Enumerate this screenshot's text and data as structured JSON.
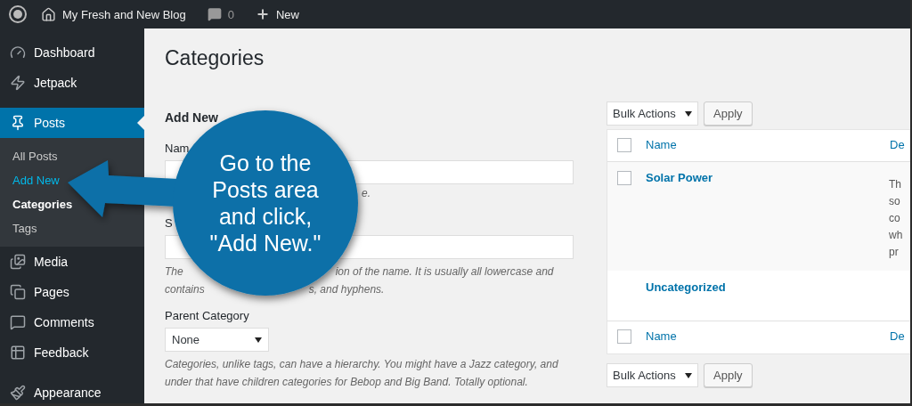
{
  "admin_bar": {
    "site_name": "My Fresh and New Blog",
    "comments_count": "0",
    "new_label": "New"
  },
  "sidebar": {
    "items": [
      {
        "label": "Dashboard",
        "selected": false
      },
      {
        "label": "Jetpack",
        "selected": false
      },
      {
        "label": "Posts",
        "selected": true,
        "children": [
          {
            "label": "All Posts",
            "selected": false,
            "hovered": false
          },
          {
            "label": "Add New",
            "selected": false,
            "hovered": true
          },
          {
            "label": "Categories",
            "selected": true,
            "hovered": false
          },
          {
            "label": "Tags",
            "selected": false,
            "hovered": false
          }
        ]
      },
      {
        "label": "Media",
        "selected": false
      },
      {
        "label": "Pages",
        "selected": false
      },
      {
        "label": "Comments",
        "selected": false
      },
      {
        "label": "Feedback",
        "selected": false
      },
      {
        "label": "Appearance",
        "selected": false
      }
    ]
  },
  "page_title": "Categories",
  "form": {
    "heading": "Add New",
    "name_label": "Nam",
    "name_hint": "e.",
    "slug_label": "S",
    "slug_hint_lines": [
      [
        "The",
        "ion of the name. It is usually all lowercase and"
      ],
      [
        "contains",
        "s, and hyphens."
      ]
    ],
    "parent_label": "Parent Category",
    "parent_value": "None",
    "parent_hint": "Categories, unlike tags, can have a hierarchy. You might have a Jazz category, and under that have children categories for Bebop and Big Band. Totally optional."
  },
  "table": {
    "top_tools": {
      "bulk_actions": "Bulk Actions",
      "apply": "Apply"
    },
    "header": {
      "columns": [
        "Name",
        "De"
      ],
      "checked": false
    },
    "rows": [
      {
        "name": "Solar Power",
        "kind": "checkable",
        "checked": false,
        "description_lines": [
          "Th",
          "so",
          "co",
          "wh",
          "pr"
        ]
      },
      {
        "name": "Uncategorized",
        "kind": "default",
        "description_lines": []
      }
    ],
    "footer": {
      "columns": [
        "Name",
        "De"
      ],
      "checked": false
    },
    "bottom_tools": {
      "bulk_actions": "Bulk Actions",
      "apply": "Apply"
    }
  },
  "callout": {
    "lines": [
      "Go to the",
      "Posts area",
      "and click,",
      "\"Add New.\""
    ]
  }
}
